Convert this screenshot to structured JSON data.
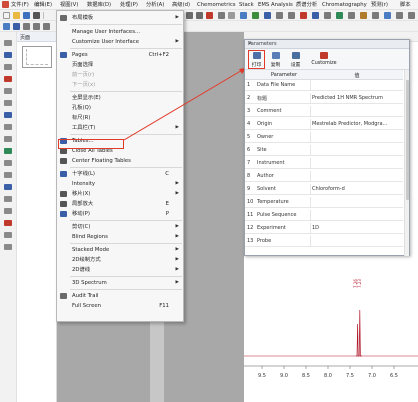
{
  "menubar": {
    "items": [
      "文件(F)",
      "编辑(E)",
      "视图(V)",
      "数据库(D)",
      "处理(P)",
      "分析(A)",
      "高级(d)",
      "Chemometrics",
      "Stack",
      "EMS Analysis",
      "质谱分析",
      "Chromatography",
      "预测(r)",
      "脚本"
    ]
  },
  "page_panel": {
    "title": "页面"
  },
  "context_menu": {
    "items": [
      {
        "label": "布局模板",
        "shortcut": "",
        "submenu": true,
        "disabled": false
      },
      {
        "label": "Manage User Interfaces...",
        "shortcut": "",
        "submenu": false,
        "disabled": false
      },
      {
        "label": "Customize User Interface",
        "shortcut": "",
        "submenu": true,
        "disabled": false
      },
      {
        "label": "Pages",
        "shortcut": "Ctrl+F2",
        "submenu": false,
        "disabled": false
      },
      {
        "label": "页面选择",
        "shortcut": "",
        "submenu": false,
        "disabled": false
      },
      {
        "label": "前一页(r)",
        "shortcut": "",
        "submenu": false,
        "disabled": true
      },
      {
        "label": "下一页(x)",
        "shortcut": "",
        "submenu": false,
        "disabled": true
      },
      {
        "label": "全屏显示(E)",
        "shortcut": "",
        "submenu": false,
        "disabled": false
      },
      {
        "label": "孔板(Q)",
        "shortcut": "",
        "submenu": false,
        "disabled": false
      },
      {
        "label": "标尺(R)",
        "shortcut": "",
        "submenu": false,
        "disabled": false
      },
      {
        "label": "工具栏(T)",
        "shortcut": "",
        "submenu": true,
        "disabled": false
      },
      {
        "label": "Tables...",
        "shortcut": "",
        "submenu": false,
        "disabled": false
      },
      {
        "label": "Close All Tables",
        "shortcut": "",
        "submenu": false,
        "disabled": false
      },
      {
        "label": "Center Floating Tables",
        "shortcut": "",
        "submenu": false,
        "disabled": false
      },
      {
        "label": "十字线(L)",
        "shortcut": "C",
        "submenu": false,
        "disabled": false
      },
      {
        "label": "Intensity",
        "shortcut": "",
        "submenu": true,
        "disabled": false
      },
      {
        "label": "移片(X)",
        "shortcut": "",
        "submenu": true,
        "disabled": false
      },
      {
        "label": "局部放大",
        "shortcut": "E",
        "submenu": false,
        "disabled": false
      },
      {
        "label": "移动(P)",
        "shortcut": "P",
        "submenu": false,
        "disabled": false
      },
      {
        "label": "剪切(C)",
        "shortcut": "",
        "submenu": true,
        "disabled": false
      },
      {
        "label": "Blind Regions",
        "shortcut": "",
        "submenu": true,
        "disabled": false
      },
      {
        "label": "Stacked Mode",
        "shortcut": "",
        "submenu": true,
        "disabled": false
      },
      {
        "label": "2D绘制方式",
        "shortcut": "",
        "submenu": true,
        "disabled": false
      },
      {
        "label": "2D谱线",
        "shortcut": "",
        "submenu": true,
        "disabled": false
      },
      {
        "label": "3D Spectrum",
        "shortcut": "",
        "submenu": true,
        "disabled": false
      },
      {
        "label": "Audit Trail",
        "shortcut": "",
        "submenu": false,
        "disabled": false
      },
      {
        "label": "Full Screen",
        "shortcut": "F11",
        "submenu": false,
        "disabled": false
      }
    ]
  },
  "params": {
    "title": "Parameters",
    "toolbar": [
      {
        "label": "打印",
        "icon": "print-icon"
      },
      {
        "label": "复制",
        "icon": "copy-icon"
      },
      {
        "label": "设置",
        "icon": "settings-icon"
      },
      {
        "label": "Customize",
        "icon": "customize-icon"
      }
    ],
    "col_param": "Parameter",
    "col_value": "值",
    "rows": [
      {
        "num": "1",
        "name": "Data File Name",
        "value": ""
      },
      {
        "num": "2",
        "name": "标题",
        "value": "Predicted 1H NMR Spectrum"
      },
      {
        "num": "3",
        "name": "Comment",
        "value": ""
      },
      {
        "num": "4",
        "name": "Origin",
        "value": "Mestrelab Predictor, Modgra..."
      },
      {
        "num": "5",
        "name": "Owner",
        "value": ""
      },
      {
        "num": "6",
        "name": "Site",
        "value": ""
      },
      {
        "num": "7",
        "name": "Instrument",
        "value": ""
      },
      {
        "num": "8",
        "name": "Author",
        "value": ""
      },
      {
        "num": "9",
        "name": "Solvent",
        "value": "Chloroform-d"
      },
      {
        "num": "10",
        "name": "Temperature",
        "value": ""
      },
      {
        "num": "11",
        "name": "Pulse Sequence",
        "value": ""
      },
      {
        "num": "12",
        "name": "Experiment",
        "value": "1D"
      },
      {
        "num": "13",
        "name": "Probe",
        "value": ""
      }
    ]
  },
  "spectrum": {
    "x_ticks": [
      "9.5",
      "9.0",
      "8.5",
      "8.0",
      "7.5",
      "7.0",
      "6.5"
    ],
    "peak_labels": [
      "7.26",
      "7.23"
    ],
    "line_color": "#b0182a"
  },
  "colors": {
    "highlight": "#e23a2a",
    "arrow": "#e23a2a"
  }
}
